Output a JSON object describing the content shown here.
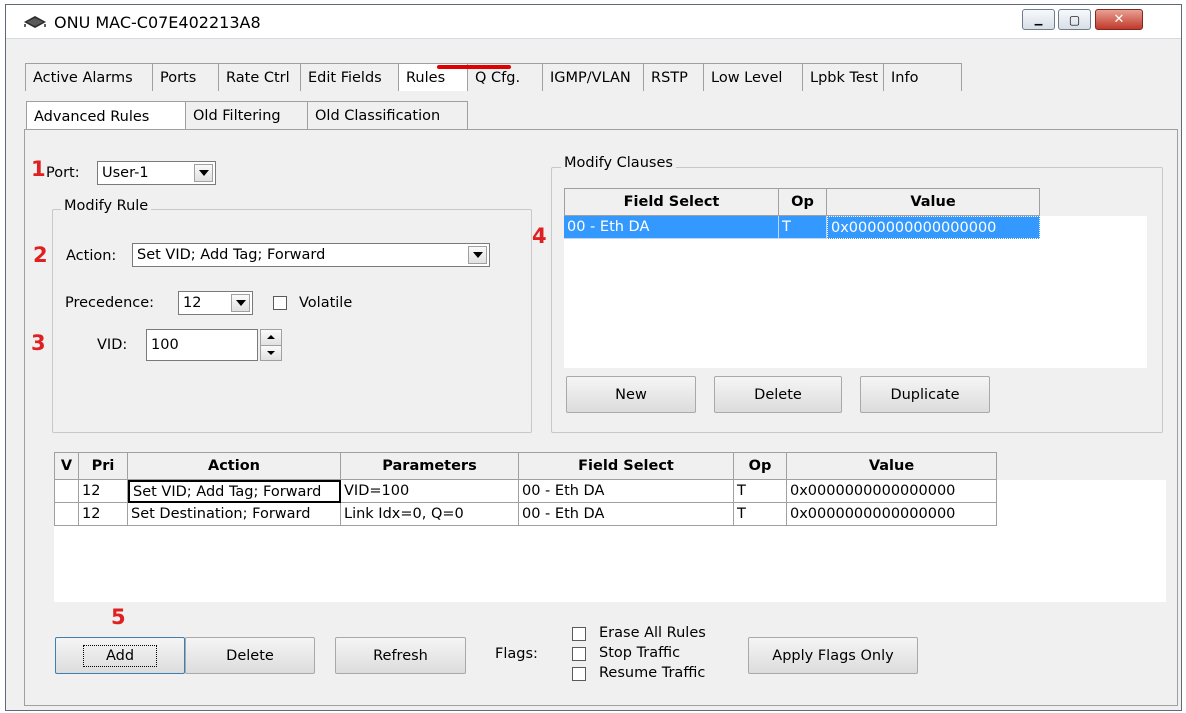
{
  "window": {
    "title": "ONU MAC-C07E402213A8",
    "minimize_label": "▁",
    "maximize_label": "▢",
    "close_label": "✕"
  },
  "main_tabs": [
    {
      "label": "Active Alarms"
    },
    {
      "label": "Ports"
    },
    {
      "label": "Rate Ctrl"
    },
    {
      "label": "Edit Fields"
    },
    {
      "label": "Rules"
    },
    {
      "label": "Q Cfg."
    },
    {
      "label": "IGMP/VLAN"
    },
    {
      "label": "RSTP"
    },
    {
      "label": "Low Level"
    },
    {
      "label": "Lpbk Test"
    },
    {
      "label": "Info"
    }
  ],
  "sub_tabs": [
    {
      "label": "Advanced Rules"
    },
    {
      "label": "Old Filtering"
    },
    {
      "label": "Old Classification"
    }
  ],
  "markers": [
    "1",
    "2",
    "3",
    "4",
    "5"
  ],
  "port": {
    "label": "Port:",
    "value": "User-1"
  },
  "modify_rule": {
    "title": "Modify Rule",
    "action_label": "Action:",
    "action_value": "Set VID; Add Tag; Forward",
    "precedence_label": "Precedence:",
    "precedence_value": "12",
    "volatile_label": "Volatile",
    "vid_label": "VID:",
    "vid_value": "100"
  },
  "modify_clauses": {
    "title": "Modify Clauses",
    "columns": [
      "Field Select",
      "Op",
      "Value"
    ],
    "rows": [
      {
        "field": "00 - Eth DA",
        "op": "T",
        "value": "0x0000000000000000"
      }
    ],
    "new_label": "New",
    "delete_label": "Delete",
    "duplicate_label": "Duplicate"
  },
  "rules_table": {
    "columns": [
      "V",
      "Pri",
      "Action",
      "Parameters",
      "Field Select",
      "Op",
      "Value"
    ],
    "rows": [
      {
        "v": "",
        "pri": "12",
        "action": "Set VID; Add Tag; Forward",
        "params": "VID=100",
        "field": "00 - Eth DA",
        "op": "T",
        "value": "0x0000000000000000"
      },
      {
        "v": "",
        "pri": "12",
        "action": "Set Destination; Forward",
        "params": "Link Idx=0, Q=0",
        "field": "00 - Eth DA",
        "op": "T",
        "value": "0x0000000000000000"
      }
    ]
  },
  "bottom": {
    "add_label": "Add",
    "delete_label": "Delete",
    "refresh_label": "Refresh",
    "flags_label": "Flags:",
    "erase_label": "Erase All Rules",
    "stop_label": "Stop Traffic",
    "resume_label": "Resume Traffic",
    "apply_label": "Apply Flags Only"
  },
  "colors": {
    "marker": "#e02020",
    "selection": "#3399ff",
    "rules_underline": "#e00000"
  }
}
